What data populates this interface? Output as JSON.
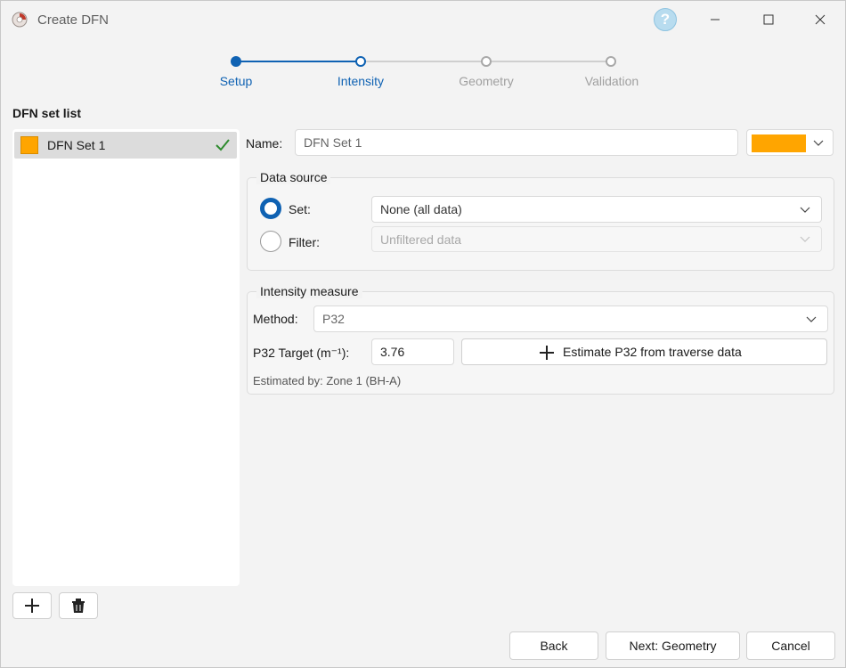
{
  "window": {
    "title": "Create DFN"
  },
  "colors": {
    "accent": "#0f62b3",
    "set_color": "#ffa500",
    "check": "#2e8b2e",
    "inactive": "#a0a0a0"
  },
  "steps": [
    {
      "label": "Setup",
      "state": "done"
    },
    {
      "label": "Intensity",
      "state": "current"
    },
    {
      "label": "Geometry",
      "state": "pending"
    },
    {
      "label": "Validation",
      "state": "pending"
    }
  ],
  "dfn_list": {
    "title": "DFN set list",
    "items": [
      {
        "label": "DFN Set 1",
        "status": "valid"
      }
    ]
  },
  "name": {
    "label": "Name:",
    "value": "DFN Set 1"
  },
  "data_source": {
    "title": "Data source",
    "set_label": "Set:",
    "set_value": "None (all data)",
    "filter_label": "Filter:",
    "filter_value": "Unfiltered data",
    "selected": "set"
  },
  "intensity": {
    "title": "Intensity measure",
    "method_label": "Method:",
    "method_value": "P32",
    "target_label": "P32 Target (m⁻¹):",
    "target_value": "3.76",
    "estimate_button": "Estimate P32 from traverse data",
    "estimated_by": "Estimated by: Zone 1 (BH-A)"
  },
  "footer": {
    "back": "Back",
    "next": "Next: Geometry",
    "cancel": "Cancel"
  },
  "icons": [
    "app-logo-icon",
    "help-icon",
    "minimize-icon",
    "maximize-icon",
    "close-icon",
    "check-icon",
    "chevron-down-icon",
    "plus-icon",
    "trash-icon"
  ]
}
